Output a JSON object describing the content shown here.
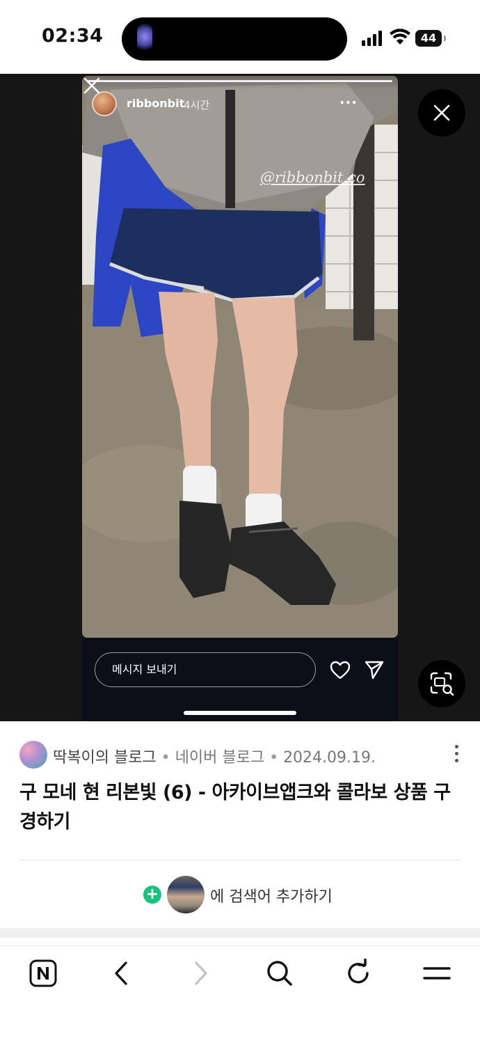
{
  "status_bar": {
    "time": "02:34",
    "battery_level": "44"
  },
  "story": {
    "username": "ribbonbit",
    "time_ago": "4시간",
    "more_label": "···",
    "watermark": "@ribbonbit.co",
    "message_placeholder": "메시지 보내기"
  },
  "blog": {
    "source_name": "딱복이의 블로그",
    "separator": " • ",
    "platform": "네이버 블로그",
    "date": "2024.09.19.",
    "title": "구 모네 현 리본빛 (6) - 아카이브앱크와 콜라보 상품 구경하기",
    "add_keyword_label": "에 검색어 추가하기"
  },
  "toolbar": {
    "icons": [
      "naver-home-icon",
      "back-icon",
      "forward-icon",
      "search-icon",
      "refresh-icon",
      "menu-icon"
    ]
  },
  "colors": {
    "viewer_background": "#161616",
    "story_footer": "#0b0f17",
    "accent_green": "#19c37d",
    "forward_disabled": "#c4c4c4"
  }
}
